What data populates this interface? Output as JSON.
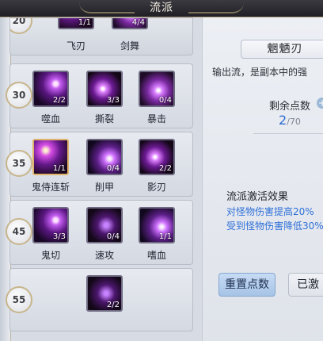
{
  "header": {
    "title": "流派"
  },
  "tiers": [
    {
      "level": "20",
      "skills": [
        {
          "name": "飞刃",
          "points": "1/1",
          "art": "art-d"
        },
        {
          "name": "剑舞",
          "points": "4/4",
          "art": "art-c"
        }
      ]
    },
    {
      "level": "30",
      "skills": [
        {
          "name": "噬血",
          "points": "2/2",
          "art": "art-a"
        },
        {
          "name": "撕裂",
          "points": "3/3",
          "art": "art-b"
        },
        {
          "name": "暴击",
          "points": "0/4",
          "art": "art-c"
        }
      ]
    },
    {
      "level": "35",
      "skills": [
        {
          "name": "鬼侍连斩",
          "points": "1/1",
          "art": "art-d",
          "selected": true
        },
        {
          "name": "削甲",
          "points": "0/4",
          "art": "art-e"
        },
        {
          "name": "影刃",
          "points": "2/2",
          "art": "art-b"
        }
      ]
    },
    {
      "level": "45",
      "skills": [
        {
          "name": "鬼切",
          "points": "3/3",
          "art": "art-a"
        },
        {
          "name": "速攻",
          "points": "0/4",
          "art": "art-dark"
        },
        {
          "name": "嗜血",
          "points": "1/1",
          "art": "art-e"
        }
      ]
    },
    {
      "level": "55",
      "skills": [
        {
          "name": "",
          "points": "2/2",
          "art": "art-dark"
        }
      ]
    }
  ],
  "detail": {
    "name": "魍魉刃",
    "description": "输出流，是副本中的强",
    "remain_label": "剩余点数",
    "remain_value": "2",
    "remain_max": "/70",
    "effect_title": "流派激活效果",
    "effect_line_1": "对怪物伤害提高20%",
    "effect_line_2": "受到怪物伤害降低30%"
  },
  "buttons": {
    "reset": "重置点数",
    "other": "已激"
  },
  "colors": {
    "accent_blue": "#2f70d8",
    "gold_border": "#e0b36c"
  }
}
